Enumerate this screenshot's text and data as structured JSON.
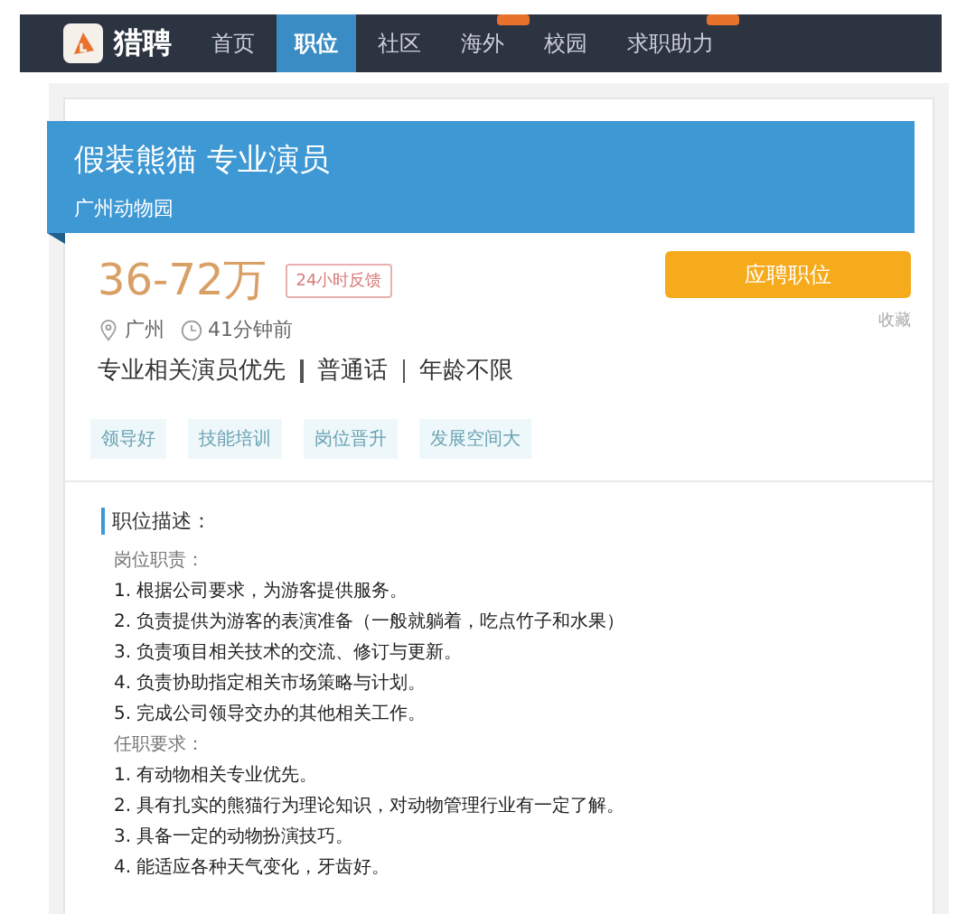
{
  "nav": {
    "brand": "猎聘",
    "items": [
      {
        "label": "首页",
        "selected": false,
        "badge": false
      },
      {
        "label": "职位",
        "selected": true,
        "badge": false
      },
      {
        "label": "社区",
        "selected": false,
        "badge": false
      },
      {
        "label": "海外",
        "selected": false,
        "badge": true
      },
      {
        "label": "校园",
        "selected": false,
        "badge": false
      },
      {
        "label": "求职助力",
        "selected": false,
        "badge": true
      }
    ]
  },
  "job": {
    "title": "假装熊猫  专业演员",
    "company": "广州动物园",
    "salary": "36-72万",
    "feedback_tag": "24小时反馈",
    "apply_button": "应聘职位",
    "favorite": "收藏",
    "location": "广州",
    "posted": "41分钟前",
    "requirements": [
      "专业相关演员优先",
      "普通话",
      "年龄不限"
    ],
    "benefits": [
      "领导好",
      "技能培训",
      "岗位晋升",
      "发展空间大"
    ]
  },
  "description": {
    "heading": "职位描述：",
    "sections": [
      {
        "title": "岗位职责：",
        "items": [
          "1. 根据公司要求，为游客提供服务。",
          "2. 负责提供为游客的表演准备（一般就躺着，吃点竹子和水果）",
          "3. 负责项目相关技术的交流、修订与更新。",
          "4. 负责协助指定相关市场策略与计划。",
          "5. 完成公司领导交办的其他相关工作。"
        ]
      },
      {
        "title": "任职要求：",
        "items": [
          "1. 有动物相关专业优先。",
          "2. 具有扎实的熊猫行为理论知识，对动物管理行业有一定了解。",
          "3. 具备一定的动物扮演技巧。",
          "4. 能适应各种天气变化，牙齿好。"
        ]
      }
    ]
  }
}
